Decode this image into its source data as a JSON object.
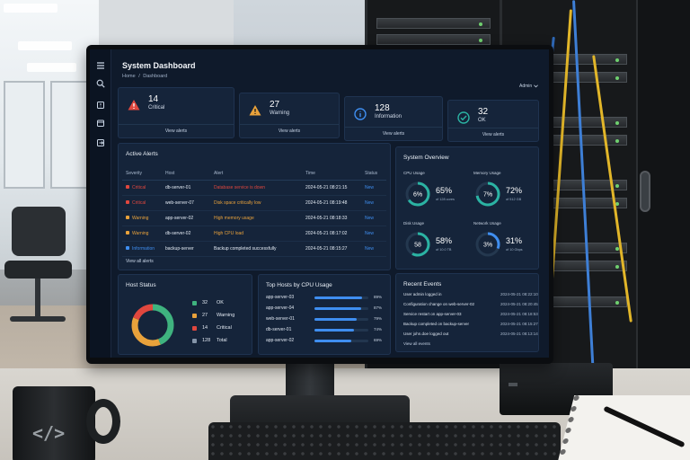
{
  "theme": {
    "screen_bg": "#0f1a2b",
    "card_bg": "#15243a",
    "critical": "#e0473e",
    "warning": "#e9a23b",
    "info": "#3f8ef0",
    "ok": "#2bb3a3",
    "link": "#3f8ef0"
  },
  "sidebar": {
    "items": [
      {
        "icon": "menu-icon"
      },
      {
        "icon": "search-icon"
      },
      {
        "icon": "alerts-icon"
      },
      {
        "icon": "calendar-icon"
      },
      {
        "icon": "export-icon"
      }
    ]
  },
  "header": {
    "title": "System Dashboard",
    "breadcrumb": [
      "Home",
      "/",
      "Dashboard"
    ],
    "user_menu": "Admin",
    "user_menu_icon": "chevron-down-icon"
  },
  "stats": [
    {
      "count": "14",
      "label": "Critical",
      "link": "View alerts",
      "icon": "critical-triangle-icon",
      "color": "#e0473e"
    },
    {
      "count": "27",
      "label": "Warning",
      "link": "View alerts",
      "icon": "warning-triangle-icon",
      "color": "#e9a23b"
    },
    {
      "count": "128",
      "label": "Information",
      "link": "View alerts",
      "icon": "info-circle-icon",
      "color": "#3f8ef0"
    },
    {
      "count": "32",
      "label": "OK",
      "link": "View alerts",
      "icon": "check-circle-icon",
      "color": "#2bb3a3"
    }
  ],
  "active_alerts": {
    "title": "Active Alerts",
    "columns": [
      "Severity",
      "Host",
      "Alert",
      "Time",
      "Status"
    ],
    "rows": [
      {
        "severity": "Critical",
        "host": "db-server-01",
        "alert": "Database service is down",
        "time": "2024-05-21 08:21:15",
        "status": "New",
        "color": "#e0473e"
      },
      {
        "severity": "Critical",
        "host": "web-server-07",
        "alert": "Disk space critically low",
        "time": "2024-05-21 08:19:48",
        "status": "New",
        "color": "#e0473e"
      },
      {
        "severity": "Warning",
        "host": "app-server-02",
        "alert": "High memory usage",
        "time": "2024-05-21 08:18:33",
        "status": "New",
        "color": "#e9a23b"
      },
      {
        "severity": "Warning",
        "host": "db-server-02",
        "alert": "High CPU load",
        "time": "2024-05-21 08:17:02",
        "status": "New",
        "color": "#e9a23b"
      },
      {
        "severity": "Information",
        "host": "backup-server",
        "alert": "Backup completed successfully",
        "time": "2024-05-21 08:15:27",
        "status": "New",
        "color": "#3f8ef0"
      }
    ],
    "link": "View all alerts"
  },
  "system_overview": {
    "title": "System Overview",
    "gauges": [
      {
        "label": "CPU Usage",
        "percent": 65,
        "value": "65%",
        "ring_text": "6%",
        "sub": "of 128 cores",
        "color": "#2bb3a3"
      },
      {
        "label": "Memory Usage",
        "percent": 72,
        "value": "72%",
        "ring_text": "7%",
        "sub": "of 512 GB",
        "color": "#2bb3a3"
      },
      {
        "label": "Disk Usage",
        "percent": 58,
        "value": "58%",
        "ring_text": "58",
        "sub": "of 10.0 TB",
        "color": "#2bb3a3"
      },
      {
        "label": "Network Usage",
        "percent": 31,
        "value": "31%",
        "ring_text": "3%",
        "sub": "of 10 Gbps",
        "color": "#3f8ef0"
      }
    ]
  },
  "host_status": {
    "title": "Host Status",
    "items": [
      {
        "count": 32,
        "label": "OK",
        "color": "#3fb37f"
      },
      {
        "count": 27,
        "label": "Warning",
        "color": "#e9a23b"
      },
      {
        "count": 14,
        "label": "Critical",
        "color": "#e0473e"
      },
      {
        "count": 128,
        "label": "Total",
        "color": "#8494a8"
      }
    ]
  },
  "top_hosts": {
    "title": "Top Hosts by CPU Usage",
    "hosts": [
      {
        "name": "app-server-03",
        "percent": 89,
        "label": "89%"
      },
      {
        "name": "app-server-04",
        "percent": 87,
        "label": "87%"
      },
      {
        "name": "web-server-01",
        "percent": 79,
        "label": "79%"
      },
      {
        "name": "db-server-01",
        "percent": 74,
        "label": "74%"
      },
      {
        "name": "app-server-02",
        "percent": 69,
        "label": "69%"
      }
    ]
  },
  "recent_events": {
    "title": "Recent Events",
    "events": [
      {
        "message": "User admin logged in",
        "time": "2024-05-21 08:22:10"
      },
      {
        "message": "Configuration change on web-server-02",
        "time": "2024-05-21 08:20:45"
      },
      {
        "message": "Service restart on app-server-03",
        "time": "2024-05-21 08:18:53"
      },
      {
        "message": "Backup completed on backup-server",
        "time": "2024-05-21 08:15:27"
      },
      {
        "message": "User john.doe logged out",
        "time": "2024-05-21 08:13:14"
      }
    ],
    "link": "View all events"
  }
}
